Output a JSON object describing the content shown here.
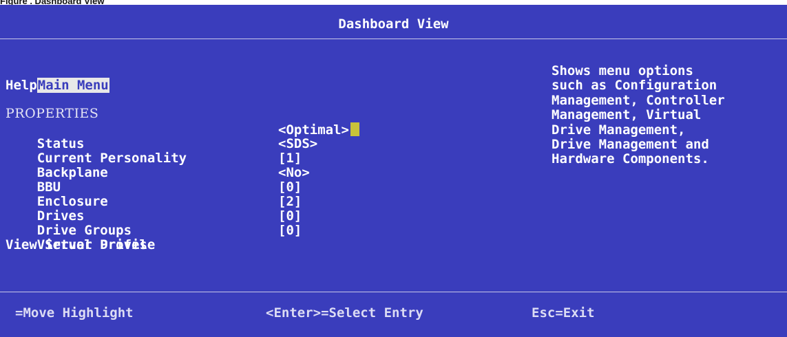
{
  "caption": "Figure . Dashboard View",
  "title": "Dashboard View",
  "menu": {
    "main_menu": "Main Menu",
    "help": "Help"
  },
  "properties": {
    "heading": "PROPERTIES",
    "rows": [
      {
        "label": "Status",
        "value": "<Optimal>"
      },
      {
        "label": "Current Personality",
        "value": "<SDS>"
      },
      {
        "label": "Backplane",
        "value": "[1]"
      },
      {
        "label": "BBU",
        "value": "<No>"
      },
      {
        "label": "Enclosure",
        "value": "[0]"
      },
      {
        "label": "Drives",
        "value": "[2]"
      },
      {
        "label": "Drive Groups",
        "value": "[0]"
      },
      {
        "label": "Virtual Drives",
        "value": "[0]"
      }
    ],
    "view_server_profile": "View Server Profile"
  },
  "help_text": [
    "Shows menu options",
    "such as Configuration",
    "Management, Controller",
    "Management, Virtual",
    "Drive Management,",
    "Drive Management and",
    "Hardware Components."
  ],
  "footer": {
    "move": "=Move Highlight",
    "select": "<Enter>=Select Entry",
    "exit": "Esc=Exit"
  },
  "colors": {
    "background": "#3a3dbc",
    "text": "#ffffff",
    "highlight_bg": "#e8e8e8",
    "cursor": "#c9c23a"
  }
}
